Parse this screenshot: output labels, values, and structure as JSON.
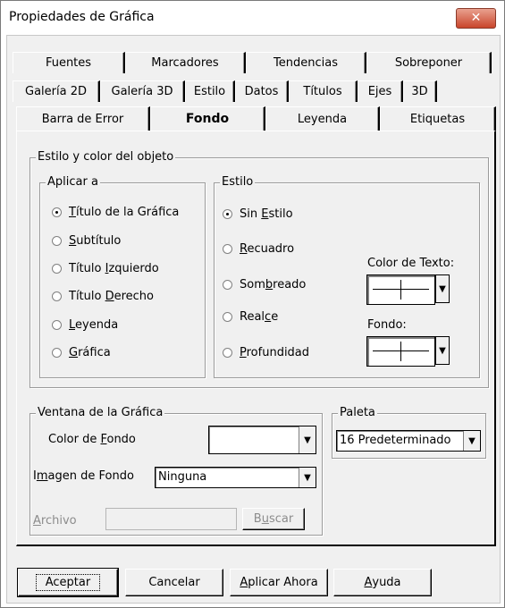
{
  "window": {
    "title": "Propiedades de Gráfica",
    "close_glyph": "✕"
  },
  "tabs": {
    "row1": [
      "Fuentes",
      "Marcadores",
      "Tendencias",
      "Sobreponer"
    ],
    "row2": [
      "Galería 2D",
      "Galería 3D",
      "Estilo",
      "Datos",
      "Títulos",
      "Ejes",
      "3D"
    ],
    "row3": [
      "Barra de Error",
      "Fondo",
      "Leyenda",
      "Etiquetas"
    ],
    "active": "Fondo"
  },
  "estilo_color": {
    "legend": "Estilo y color del objeto",
    "aplicar": {
      "legend": "Aplicar a",
      "options": [
        {
          "pre": "",
          "u": "T",
          "post": "ítulo de la Gráfica",
          "checked": true
        },
        {
          "pre": "",
          "u": "S",
          "post": "ubtítulo",
          "checked": false
        },
        {
          "pre": "Título ",
          "u": "I",
          "post": "zquierdo",
          "checked": false
        },
        {
          "pre": "Título ",
          "u": "D",
          "post": "erecho",
          "checked": false
        },
        {
          "pre": "",
          "u": "L",
          "post": "eyenda",
          "checked": false
        },
        {
          "pre": "",
          "u": "G",
          "post": "ráfica",
          "checked": false
        }
      ]
    },
    "estilo": {
      "legend": "Estilo",
      "options": [
        {
          "pre": "Sin ",
          "u": "E",
          "post": "stilo",
          "checked": true
        },
        {
          "pre": "",
          "u": "R",
          "post": "ecuadro",
          "checked": false
        },
        {
          "pre": "Som",
          "u": "b",
          "post": "reado",
          "checked": false
        },
        {
          "pre": "Real",
          "u": "c",
          "post": "e",
          "checked": false
        },
        {
          "pre": "",
          "u": "P",
          "post": "rofundidad",
          "checked": false
        }
      ],
      "color_texto_label": "Color de Texto:",
      "fondo_label": "Fondo:"
    }
  },
  "ventana": {
    "legend": "Ventana de la Gráfica",
    "color_fondo": {
      "pre": "Color de ",
      "u": "F",
      "post": "ondo",
      "value": ""
    },
    "imagen_fondo": {
      "pre": "I",
      "u": "m",
      "post": "agen de Fondo",
      "value": "Ninguna"
    },
    "archivo": {
      "pre": "",
      "u": "A",
      "post": "rchivo",
      "value": ""
    },
    "buscar": {
      "pre": "B",
      "u": "u",
      "post": "scar"
    }
  },
  "paleta": {
    "legend": "Paleta",
    "value": "16  Predeterminado"
  },
  "buttons": {
    "aceptar": "Aceptar",
    "cancelar": "Cancelar",
    "aplicar": {
      "pre": "",
      "u": "A",
      "post": "plicar Ahora"
    },
    "ayuda": {
      "pre": "",
      "u": "A",
      "post": "yuda"
    }
  },
  "icons": {
    "dropdown": "▼",
    "radio": "radio-button"
  }
}
